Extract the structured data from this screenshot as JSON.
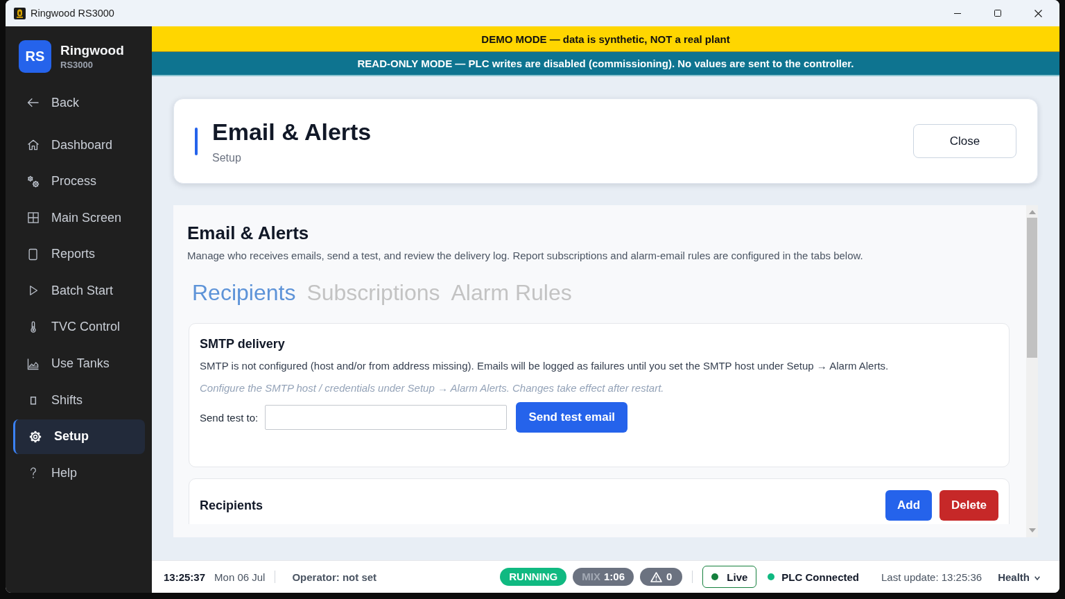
{
  "window": {
    "title": "Ringwood RS3000"
  },
  "sidebar": {
    "brand": {
      "logo": "RS",
      "name": "Ringwood",
      "model": "RS3000"
    },
    "back": "Back",
    "items": [
      {
        "label": "Dashboard",
        "selected": false
      },
      {
        "label": "Process",
        "selected": false
      },
      {
        "label": "Main Screen",
        "selected": false
      },
      {
        "label": "Reports",
        "selected": false
      },
      {
        "label": "Batch Start",
        "selected": false
      },
      {
        "label": "TVC Control",
        "selected": false
      },
      {
        "label": "Use Tanks",
        "selected": false
      },
      {
        "label": "Shifts",
        "selected": false
      },
      {
        "label": "Setup",
        "selected": true
      },
      {
        "label": "Help",
        "selected": false
      }
    ]
  },
  "banners": [
    {
      "kind": "demo",
      "text": "DEMO MODE — data is synthetic, NOT a real plant"
    },
    {
      "kind": "read_only",
      "text": "READ-ONLY MODE — PLC writes are disabled (commissioning). No values are sent to the controller."
    }
  ],
  "header": {
    "title": "Email & Alerts",
    "subtitle": "Setup",
    "close": "Close"
  },
  "panel": {
    "title": "Email & Alerts",
    "description": "Manage who receives emails, send a test, and review the delivery log. Report subscriptions and alarm-email rules are configured in the tabs below.",
    "tabs": [
      {
        "label": "Recipients",
        "selected": true
      },
      {
        "label": "Subscriptions",
        "selected": false
      },
      {
        "label": "Alarm Rules",
        "selected": false
      }
    ],
    "smtp": {
      "title": "SMTP delivery",
      "status": "SMTP is not configured (host and/or from address missing). Emails will be logged as failures until you set the SMTP host under Setup → Alarm Alerts.",
      "hint": "Configure the SMTP host / credentials under Setup → Alarm Alerts. Changes take effect after restart.",
      "test_label": "Send test to:",
      "send_button": "Send test email"
    },
    "recipients": {
      "title": "Recipients",
      "buttons": [
        {
          "kind": "primary",
          "label": "Add"
        },
        {
          "kind": "danger",
          "label": "Delete"
        }
      ]
    }
  },
  "status_bar": {
    "time": "13:25:37",
    "date": "Mon 06 Jul",
    "operator": "Operator: not set",
    "pills": [
      {
        "kind": "state",
        "text": "RUNNING"
      },
      {
        "kind": "mix",
        "label": "MIX",
        "text": "1:06"
      },
      {
        "kind": "alarms",
        "text": "0"
      }
    ],
    "live": {
      "label": "Live",
      "on": true
    },
    "plc": {
      "label": "PLC Connected",
      "connected": true
    },
    "last_update": "Last update: 13:25:36",
    "health": "Health"
  }
}
